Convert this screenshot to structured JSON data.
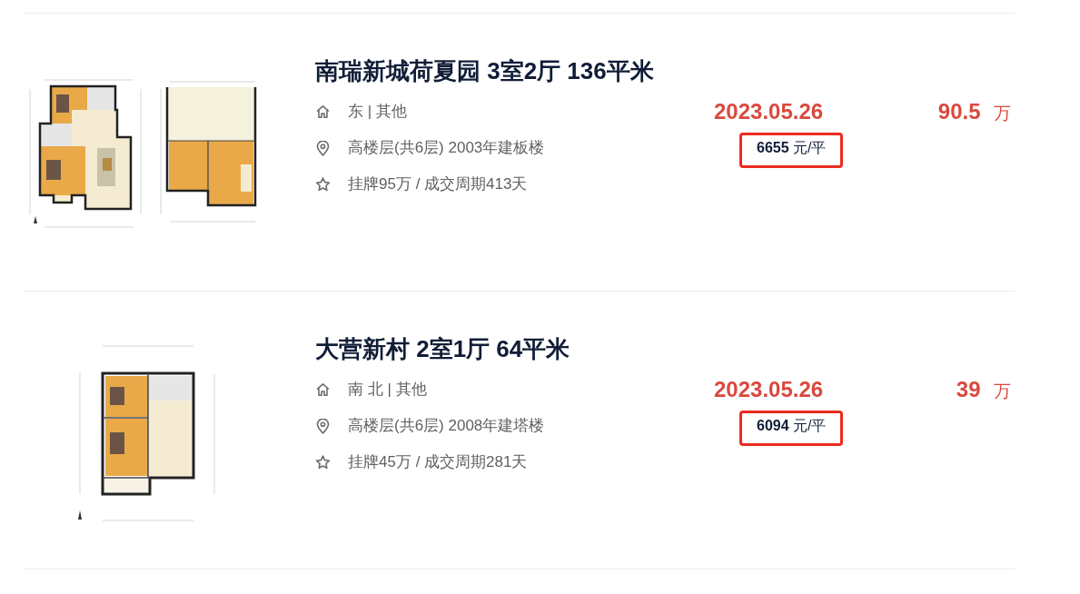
{
  "listings": [
    {
      "floor_plan": {
        "kind": "duplex"
      },
      "title": "南瑞新城荷夏园 3室2厅 136平米",
      "details": [
        {
          "kind": "orientation",
          "text": "东 | 其他"
        },
        {
          "kind": "location",
          "text": "高楼层(共6层) 2003年建板楼"
        },
        {
          "kind": "listing",
          "text": "挂牌95万 / 成交周期413天"
        }
      ],
      "deal_date": "2023.05.26",
      "unit_price": "**6655** 元/平",
      "unit_price_highlighted": true,
      "total_price": "90.5",
      "total_price_unit": "万"
    },
    {
      "floor_plan": {
        "kind": "flat"
      },
      "title": "大营新村 2室1厅 64平米",
      "details": [
        {
          "kind": "orientation",
          "text": "南 北 | 其他"
        },
        {
          "kind": "location",
          "text": "高楼层(共6层) 2008年建塔楼"
        },
        {
          "kind": "listing",
          "text": "挂牌45万 / 成交周期281天"
        }
      ],
      "deal_date": "2023.05.26",
      "unit_price": "**6094** 元/平",
      "unit_price_highlighted": true,
      "total_price": "39",
      "total_price_unit": "万"
    }
  ]
}
